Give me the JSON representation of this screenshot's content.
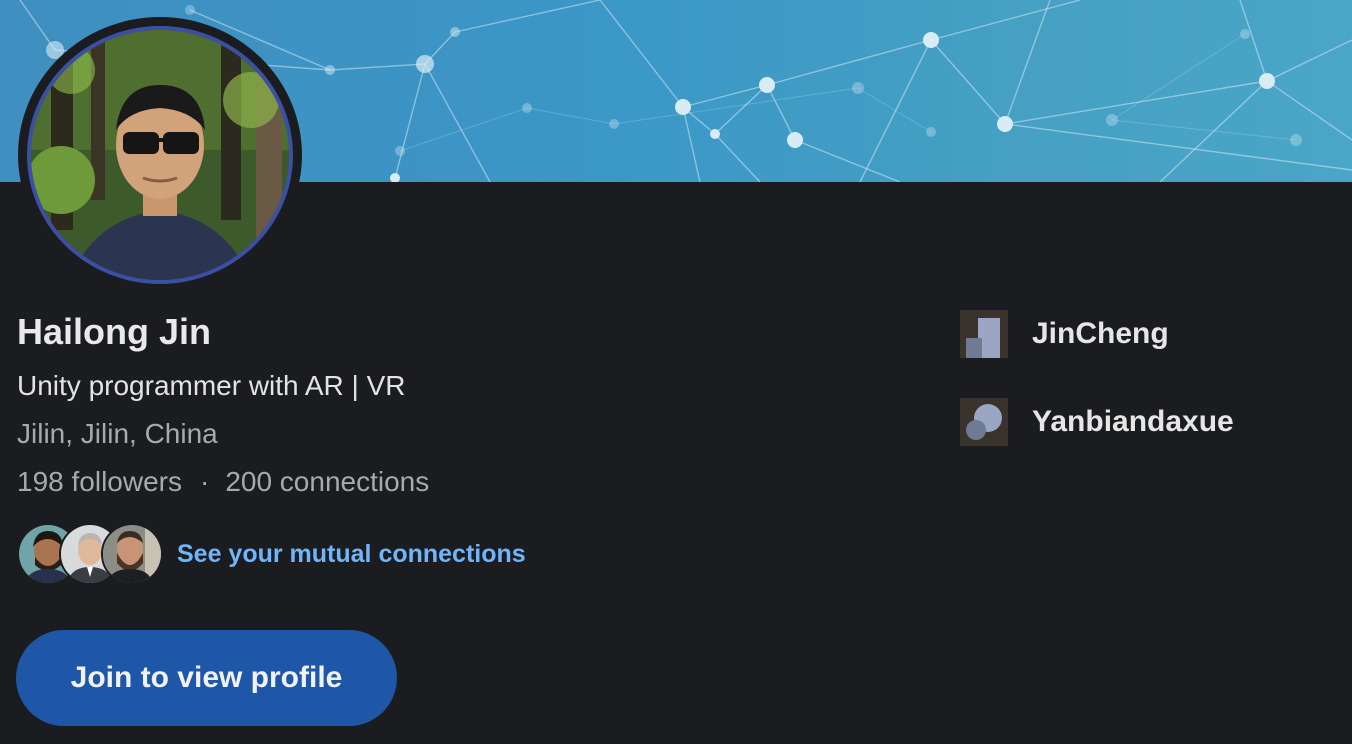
{
  "profile": {
    "name": "Hailong Jin",
    "headline": "Unity programmer with AR | VR",
    "location": "Jilin, Jilin, China",
    "followers": "198 followers",
    "separator": "·",
    "connections": "200 connections"
  },
  "mutual": {
    "link_label": "See your mutual connections"
  },
  "cta": {
    "join_label": "Join to view profile"
  },
  "experience": [
    {
      "name": "JinCheng",
      "icon": "company-logo-icon"
    },
    {
      "name": "Yanbiandaxue",
      "icon": "school-logo-icon"
    }
  ],
  "colors": {
    "background": "#1b1c1f",
    "link": "#70b5f9",
    "button": "#1f57a8",
    "avatar_ring": "#3b4fa6"
  }
}
